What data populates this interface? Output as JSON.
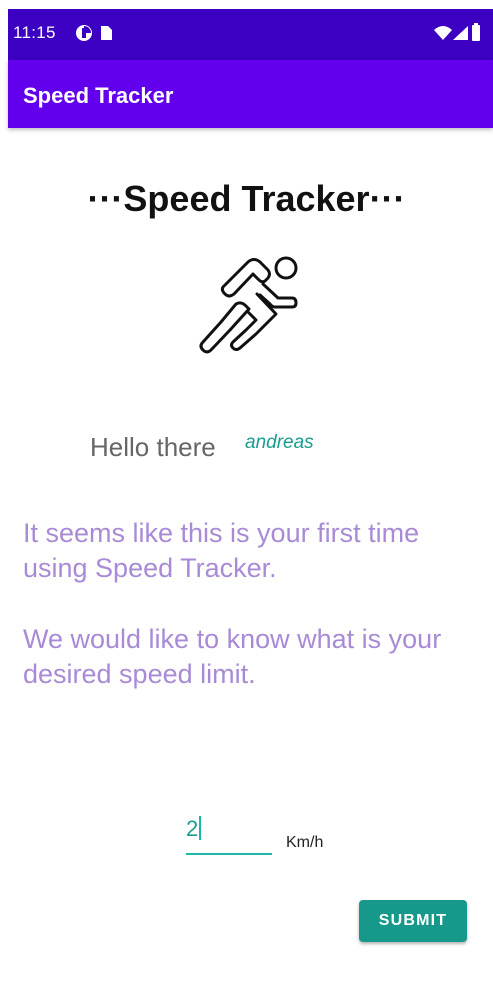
{
  "status_bar": {
    "time": "11:15",
    "color": "#3b00c2",
    "icons": [
      "notification-icon",
      "sim-card-icon",
      "wifi-icon",
      "signal-icon",
      "battery-icon"
    ]
  },
  "app_bar": {
    "title": "Speed Tracker",
    "color": "#6200ee"
  },
  "main": {
    "heading": "···Speed Tracker···",
    "illustration": "running-person-icon",
    "greeting": "Hello there",
    "username": "andreas",
    "message_1": "It seems like this is your first time using Speed Tracker.",
    "message_2": "We would like to know what is your desired speed limit.",
    "speed_input": {
      "value": "2"
    },
    "unit": "Km/h",
    "submit_label": "SUBMIT"
  },
  "colors": {
    "accent": "#1a9c8e",
    "message_text": "#a88ad6",
    "button": "#16988a"
  }
}
